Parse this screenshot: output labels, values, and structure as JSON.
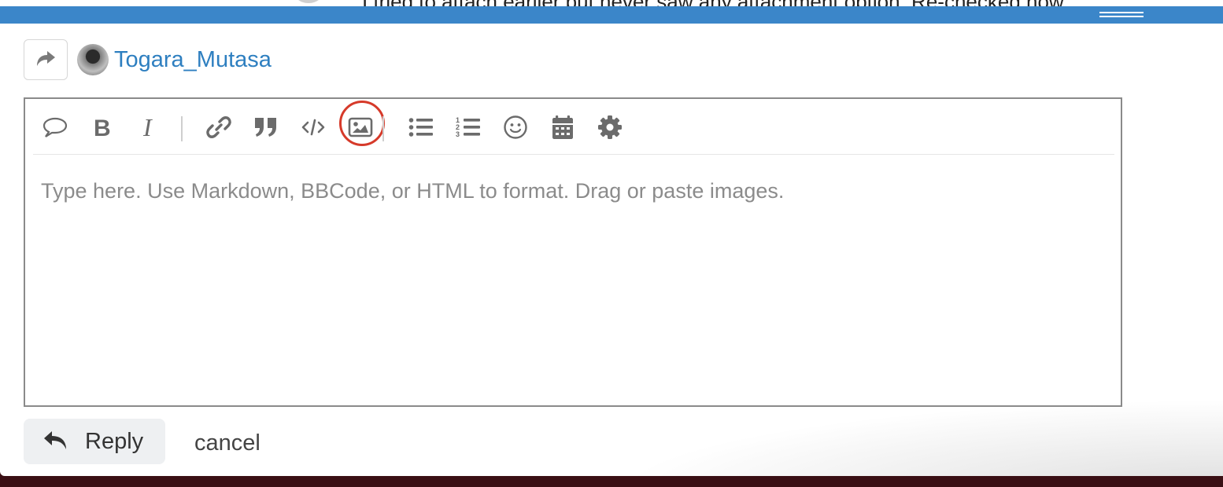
{
  "background_post": {
    "text": "I tried to attach earlier but never saw any attachment option. Re-checked now"
  },
  "composer": {
    "reply_to_user": "Togara_Mutasa",
    "toolbar": [
      {
        "name": "quote-icon",
        "title": "Quote whole post"
      },
      {
        "name": "bold-icon",
        "title": "Strong"
      },
      {
        "name": "italic-icon",
        "title": "Emphasis"
      },
      {
        "name": "link-icon",
        "title": "Hyperlink"
      },
      {
        "name": "blockquote-icon",
        "title": "Blockquote"
      },
      {
        "name": "code-icon",
        "title": "Preformatted text"
      },
      {
        "name": "image-icon",
        "title": "Upload"
      },
      {
        "name": "bullet-list-icon",
        "title": "Bulleted List"
      },
      {
        "name": "numbered-list-icon",
        "title": "Numbered List"
      },
      {
        "name": "emoji-icon",
        "title": "Insert emoji"
      },
      {
        "name": "calendar-icon",
        "title": "Insert date"
      },
      {
        "name": "gear-icon",
        "title": "Options"
      }
    ],
    "highlight_color": "#d63a2a",
    "grip_bar_color": "#3b86c9",
    "username_color": "#2e7fc0",
    "editor_placeholder": "Type here. Use Markdown, BBCode, or HTML to format. Drag or paste images.",
    "reply_label": "Reply",
    "cancel_label": "cancel"
  }
}
